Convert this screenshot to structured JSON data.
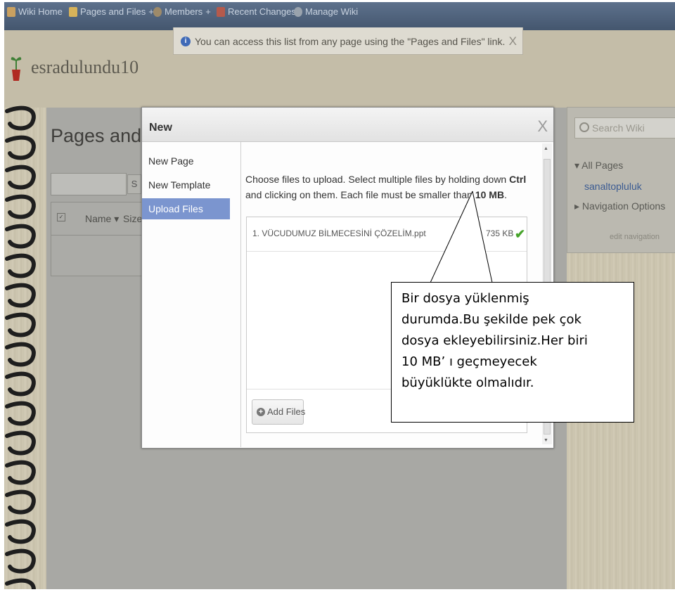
{
  "topbar": {
    "items": [
      "Wiki Home",
      "Pages and Files",
      "Members",
      "Recent Changes",
      "Manage Wiki"
    ],
    "add_symbol": "+"
  },
  "notice": {
    "text": "You can access this list from any page using the \"Pages and Files\" link.",
    "info_symbol": "i",
    "close_symbol": "X"
  },
  "site": {
    "name": "esradulundu10"
  },
  "background_page": {
    "title": "Pages and Files",
    "search_button": "Search",
    "columns": {
      "name": "Name",
      "size": "Size"
    },
    "sort_symbol": "▾",
    "checkbox_symbol": "✓"
  },
  "right_panel": {
    "search_placeholder": "Search Wiki",
    "all_pages": "All Pages",
    "page_link": "sanaltopluluk",
    "navigation_options": "Navigation Options",
    "edit_navigation": "edit navigation",
    "arrow_down": "▾",
    "arrow_right": "▸"
  },
  "modal": {
    "title": "New",
    "close_symbol": "X",
    "menu": [
      "New Page",
      "New Template",
      "Upload Files"
    ],
    "active_menu": "Upload Files",
    "instructions": {
      "part1": "Choose files to upload. Select multiple files by holding down ",
      "key": "Ctrl",
      "part2": " and clicking on them. Each file must be smaller than ",
      "limit": "10 MB",
      "part3": "."
    },
    "files": [
      {
        "name": "1. VÜCUDUMUZ BİLMECESİNİ ÇÖZELİM.ppt",
        "size": "735 KB",
        "status_symbol": "✔"
      }
    ],
    "add_files": {
      "label": "Add Files",
      "symbol": "+"
    },
    "scroll_up": "▲",
    "scroll_down": "▼"
  },
  "callout": {
    "lines": [
      "Bir dosya yüklenmiş",
      "durumda.Bu şekilde pek çok",
      "dosya ekleyebilirsiniz.Her biri",
      "10 MB’ ı geçmeyecek",
      "büyüklükte olmalıdır."
    ]
  },
  "colors": {
    "accent_active": "#7b95cf",
    "success": "#46a32a",
    "link": "#3b5b92",
    "info": "#3f6ab7"
  }
}
